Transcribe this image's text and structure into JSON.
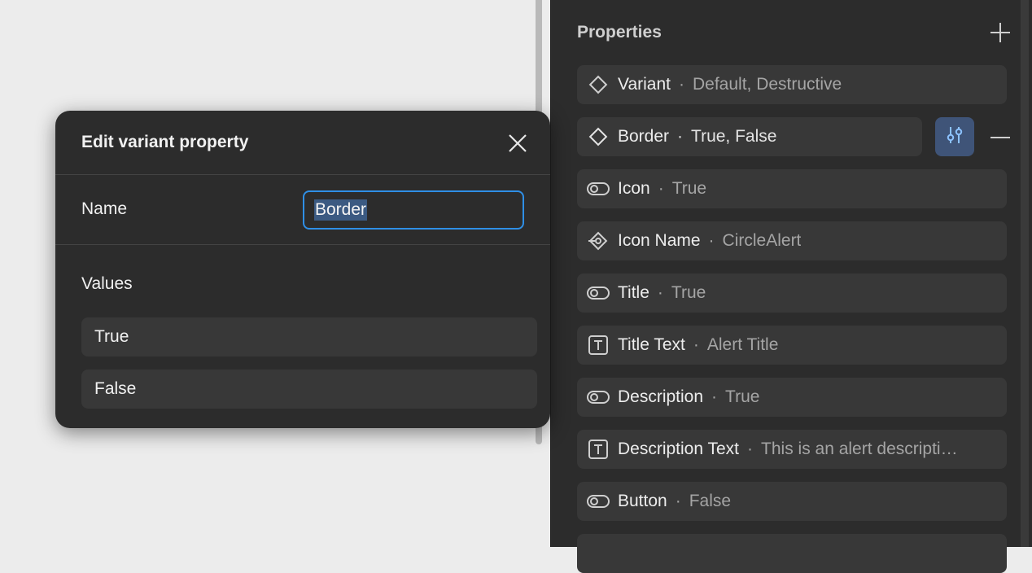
{
  "panel": {
    "title": "Properties",
    "properties": [
      {
        "name": "Variant",
        "value": "Default, Destructive",
        "icon": "variant-diamond-icon"
      },
      {
        "name": "Border",
        "value": "True, False",
        "icon": "variant-diamond-icon"
      },
      {
        "name": "Icon",
        "value": "True",
        "icon": "boolean-toggle-icon"
      },
      {
        "name": "Icon Name",
        "value": "CircleAlert",
        "icon": "instance-swap-icon"
      },
      {
        "name": "Title",
        "value": "True",
        "icon": "boolean-toggle-icon"
      },
      {
        "name": "Title Text",
        "value": "Alert Title",
        "icon": "text-icon"
      },
      {
        "name": "Description",
        "value": "True",
        "icon": "boolean-toggle-icon"
      },
      {
        "name": "Description Text",
        "value": "This is an alert descripti…",
        "icon": "text-icon"
      },
      {
        "name": "Button",
        "value": "False",
        "icon": "boolean-toggle-icon"
      }
    ],
    "separator": "·",
    "colors": {
      "accent": "#2f8fe6",
      "selected_button": "#3f5478"
    }
  },
  "modal": {
    "title": "Edit variant property",
    "name_label": "Name",
    "name_value": "Border",
    "values_label": "Values",
    "values": [
      "True",
      "False"
    ]
  }
}
